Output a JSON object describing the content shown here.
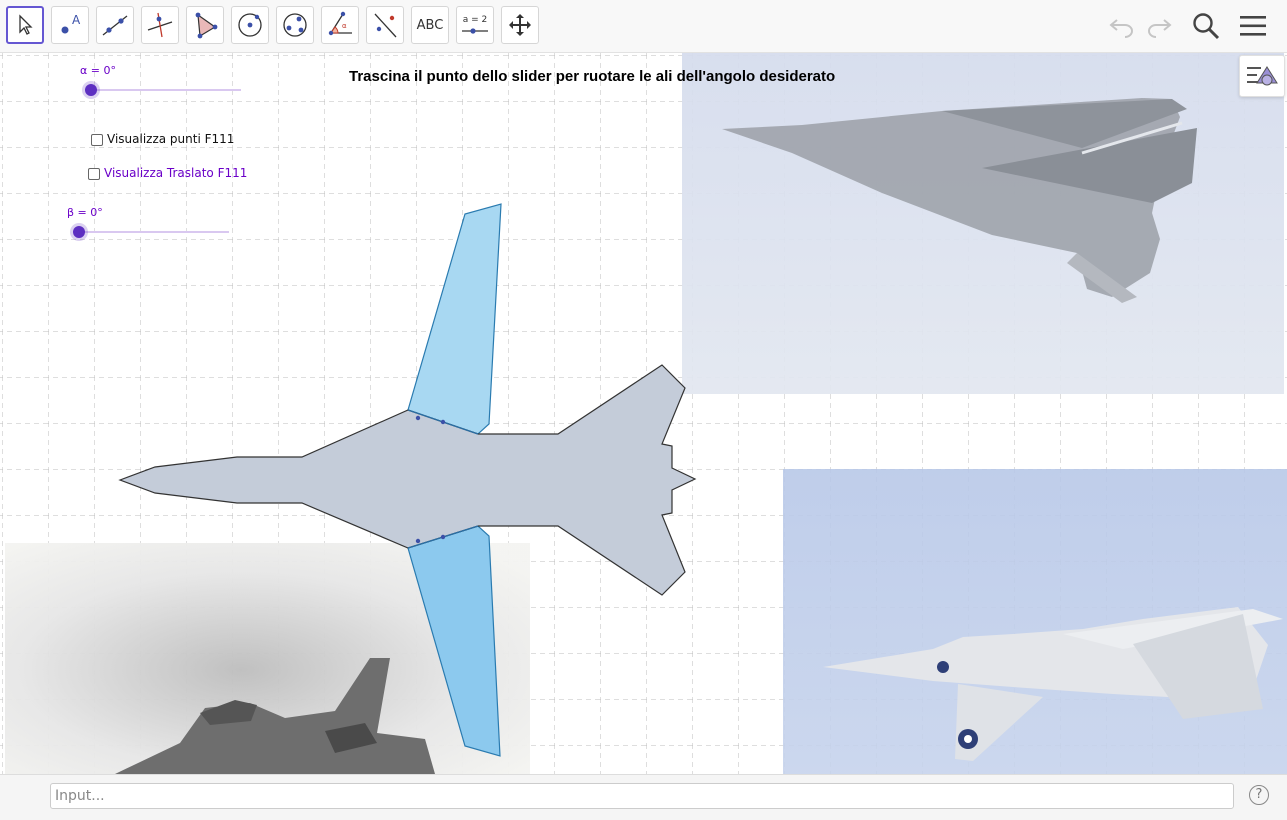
{
  "toolbar": {
    "tools": [
      {
        "name": "move-tool"
      },
      {
        "name": "point-tool",
        "label": "A"
      },
      {
        "name": "line-tool"
      },
      {
        "name": "perpendicular-line-tool"
      },
      {
        "name": "polygon-tool"
      },
      {
        "name": "circle-center-point-tool"
      },
      {
        "name": "circle-three-points-tool"
      },
      {
        "name": "angle-tool"
      },
      {
        "name": "reflect-tool"
      },
      {
        "name": "text-tool",
        "label": "ABC"
      },
      {
        "name": "slider-tool",
        "label": "a = 2"
      },
      {
        "name": "move-graphics-view-tool"
      }
    ],
    "right_icons": [
      "undo-icon",
      "redo-icon",
      "search-icon",
      "menu-icon"
    ]
  },
  "canvas": {
    "instruction": "Trascina il punto dello slider per ruotare le ali dell'angolo desiderato",
    "slider_alpha": {
      "label": "α = 0°",
      "value": 0
    },
    "slider_beta": {
      "label": "β = 0°",
      "value": 0
    },
    "checkbox_points": {
      "label": "Visualizza punti F111",
      "checked": false
    },
    "checkbox_translated": {
      "label": "Visualizza Traslato F111",
      "checked": false
    },
    "colors": {
      "fuselage": "#c4ccd9",
      "wing_upper": "#a8d8f2",
      "wing_lower": "#8cc9ee",
      "slider": "#5d2fc1",
      "label": "#6a00c8"
    }
  },
  "input_bar": {
    "placeholder": "Input..."
  }
}
